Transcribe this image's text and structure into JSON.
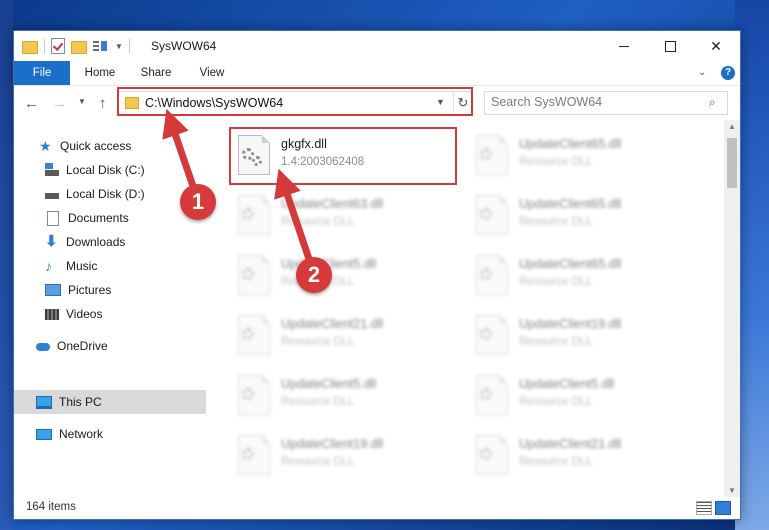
{
  "window": {
    "title": "SysWOW64"
  },
  "ribbon": {
    "tabs": [
      "File",
      "Home",
      "Share",
      "View"
    ]
  },
  "address": {
    "path": "C:\\Windows\\SysWOW64"
  },
  "search": {
    "placeholder": "Search SysWOW64"
  },
  "sidebar": {
    "items": [
      {
        "label": "Quick access",
        "icon": "star-icon",
        "pinned": false
      },
      {
        "label": "Local Disk (C:)",
        "icon": "drive-icon",
        "pinned": true
      },
      {
        "label": "Local Disk (D:)",
        "icon": "drive-icon",
        "pinned": false
      },
      {
        "label": "Documents",
        "icon": "document-icon",
        "pinned": false
      },
      {
        "label": "Downloads",
        "icon": "download-icon",
        "pinned": true
      },
      {
        "label": "Music",
        "icon": "music-icon",
        "pinned": true
      },
      {
        "label": "Pictures",
        "icon": "pictures-icon",
        "pinned": true
      },
      {
        "label": "Videos",
        "icon": "videos-icon",
        "pinned": true
      },
      {
        "label": "OneDrive",
        "icon": "cloud-icon",
        "pinned": false
      },
      {
        "label": "This PC",
        "icon": "computer-icon",
        "pinned": false,
        "selected": true
      },
      {
        "label": "Network",
        "icon": "network-icon",
        "pinned": false
      }
    ]
  },
  "files": [
    {
      "name": "gkgfx.dll",
      "desc": "1.4:2003062408",
      "highlighted": true
    },
    {
      "name": "UpdateClient65.dll",
      "desc": "Resource DLL"
    },
    {
      "name": "UpdateClient63.dll",
      "desc": "Resource DLL"
    },
    {
      "name": "UpdateClient65.dll",
      "desc": "Resource DLL"
    },
    {
      "name": "UpdateClient5.dll",
      "desc": "Resource DLL"
    },
    {
      "name": "UpdateClient65.dll",
      "desc": "Resource DLL"
    },
    {
      "name": "UpdateClient21.dll",
      "desc": "Resource DLL"
    },
    {
      "name": "UpdateClient19.dll",
      "desc": "Resource DLL"
    },
    {
      "name": "UpdateClient5.dll",
      "desc": "Resource DLL"
    },
    {
      "name": "UpdateClient5.dll",
      "desc": "Resource DLL"
    },
    {
      "name": "UpdateClient19.dll",
      "desc": "Resource DLL"
    },
    {
      "name": "UpdateClient21.dll",
      "desc": "Resource DLL"
    }
  ],
  "status": {
    "item_count": "164 items"
  },
  "annotations": {
    "step1": "1",
    "step2": "2",
    "color": "#d33b3b"
  },
  "colors": {
    "accent": "#1a6fc9",
    "highlight": "#d33b3b"
  }
}
